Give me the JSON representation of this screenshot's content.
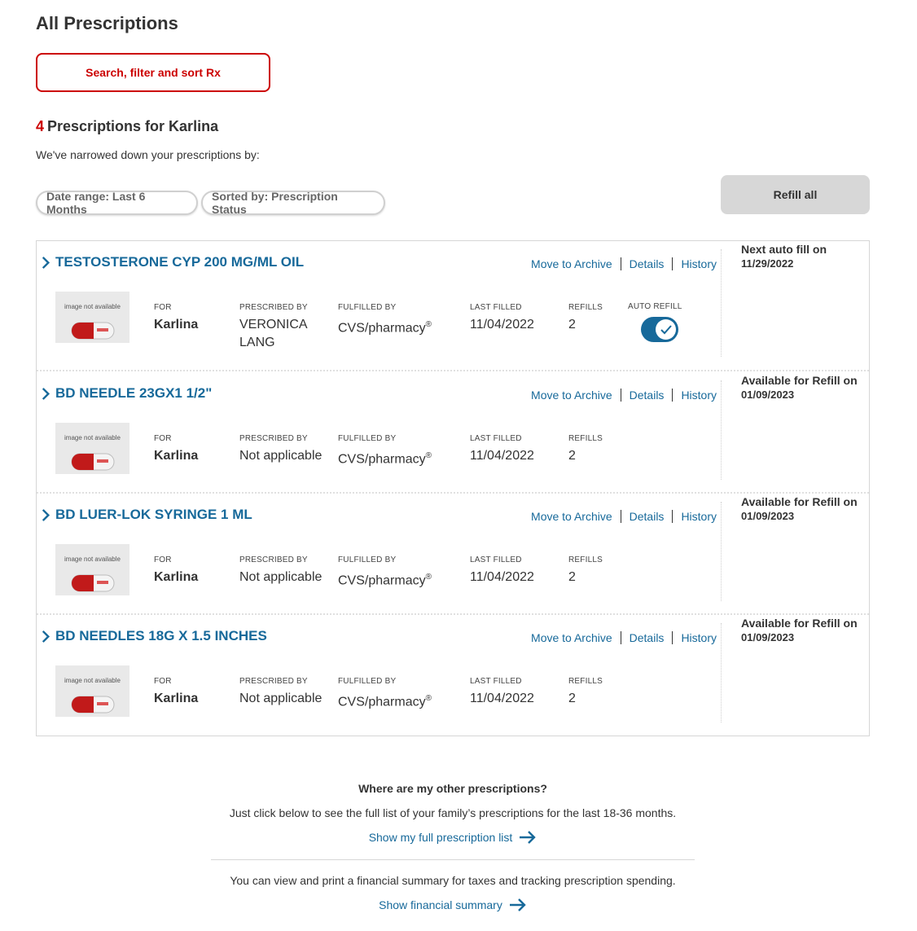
{
  "page": {
    "title": "All Prescriptions",
    "search_button": "Search, filter and sort Rx",
    "count": "4",
    "count_heading": "Prescriptions for Karlina",
    "narrowed_text": "We've narrowed down your prescriptions by:",
    "filters": [
      "Date range: Last 6 Months",
      "Sorted by: Prescription Status"
    ],
    "refill_all": "Refill all"
  },
  "labels": {
    "for": "FOR",
    "prescribed_by": "PRESCRIBED BY",
    "fulfilled_by": "FULFILLED BY",
    "last_filled": "LAST FILLED",
    "refills": "REFILLS",
    "auto_refill": "AUTO REFILL",
    "image_na": "image not available",
    "move_to_archive": "Move to Archive",
    "details": "Details",
    "history": "History",
    "registered": "®"
  },
  "prescriptions": [
    {
      "name": "TESTOSTERONE CYP 200 MG/ML OIL",
      "for": "Karlina",
      "prescribed_by": "VERONICA LANG",
      "fulfilled_by": "CVS/pharmacy",
      "last_filled": "11/04/2022",
      "refills": "2",
      "auto_refill": true,
      "status_label": "Next auto fill on",
      "status_date": "11/29/2022"
    },
    {
      "name": "BD NEEDLE 23GX1 1/2\"",
      "for": "Karlina",
      "prescribed_by": "Not applicable",
      "fulfilled_by": "CVS/pharmacy",
      "last_filled": "11/04/2022",
      "refills": "2",
      "status_label": "Available for Refill on",
      "status_date": "01/09/2023"
    },
    {
      "name": "BD LUER-LOK SYRINGE 1 ML",
      "for": "Karlina",
      "prescribed_by": "Not applicable",
      "fulfilled_by": "CVS/pharmacy",
      "last_filled": "11/04/2022",
      "refills": "2",
      "status_label": "Available for Refill on",
      "status_date": "01/09/2023"
    },
    {
      "name": "BD NEEDLES 18G X 1.5 INCHES",
      "for": "Karlina",
      "prescribed_by": "Not applicable",
      "fulfilled_by": "CVS/pharmacy",
      "last_filled": "11/04/2022",
      "refills": "2",
      "status_label": "Available for Refill on",
      "status_date": "01/09/2023"
    }
  ],
  "other": {
    "question": "Where are my other prescriptions?",
    "desc": "Just click below to see the full list of your family’s prescriptions for the last 18-36 months.",
    "full_list_link": "Show my full prescription list",
    "financial_desc": "You can view and print a financial summary for taxes and tracking prescription spending.",
    "financial_link": "Show financial summary"
  },
  "colors": {
    "brand_red": "#cc0000",
    "link_blue": "#17699a",
    "toggle_on": "#17699a"
  }
}
